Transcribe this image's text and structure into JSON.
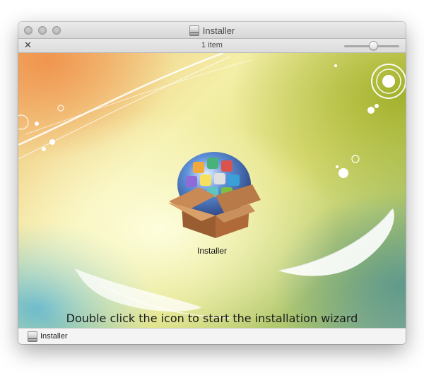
{
  "window": {
    "title": "Installer",
    "title_icon": "disk-icon"
  },
  "toolbar": {
    "item_count": "1 item",
    "tools_icon": "tools-icon"
  },
  "content": {
    "icon_label": "Installer",
    "instruction": "Double click the icon to start the installation wizard"
  },
  "pathbar": {
    "label": "Installer"
  },
  "colors": {
    "window_bg": "#ececec",
    "titlebar_top": "#ebebeb",
    "titlebar_bottom": "#d6d6d6",
    "box_brown": "#a8683a"
  }
}
